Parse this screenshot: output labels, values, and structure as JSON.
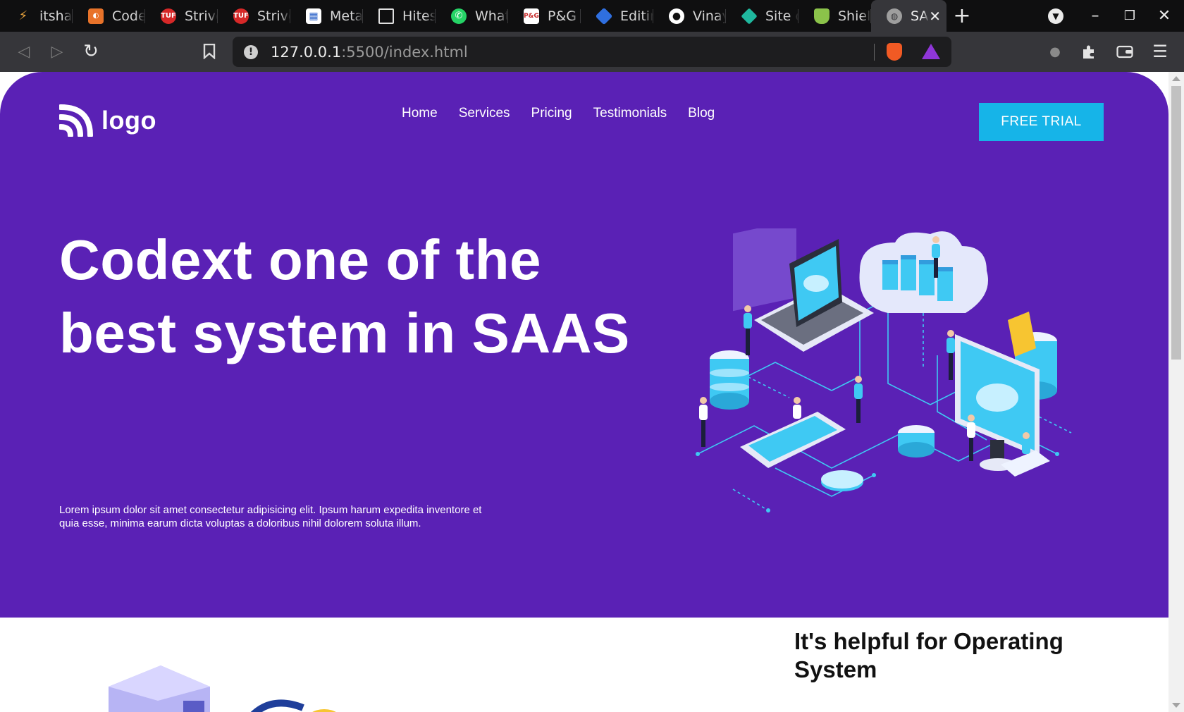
{
  "browser": {
    "tabs": [
      {
        "label": "itshar",
        "favicon": "orange-bolt-icon",
        "color": "#e8a33d"
      },
      {
        "label": "Code",
        "favicon": "codechef-icon",
        "color": "#e8732a"
      },
      {
        "label": "Strive",
        "favicon": "tuf-icon",
        "color": "#d62828"
      },
      {
        "label": "Strive",
        "favicon": "tuf-icon",
        "color": "#d62828"
      },
      {
        "label": "Meta",
        "favicon": "grid-icon",
        "color": "#2b63c9"
      },
      {
        "label": "Hites",
        "favicon": "square-outline-icon",
        "color": "#0f0f10"
      },
      {
        "label": "What",
        "favicon": "whatsapp-icon",
        "color": "#25d366"
      },
      {
        "label": "P&G F",
        "favicon": "pg-icon",
        "color": "#ffffff"
      },
      {
        "label": "Editin",
        "favicon": "diamond-icon",
        "color": "#2f6fe0"
      },
      {
        "label": "Vinay",
        "favicon": "github-icon",
        "color": "#ffffff"
      },
      {
        "label": "Site o",
        "favicon": "teal-diamond-icon",
        "color": "#1fb89e"
      },
      {
        "label": "Shiel",
        "favicon": "shield-icon",
        "color": "#8bc34a"
      },
      {
        "label": "SA",
        "favicon": "globe-icon",
        "color": "#9e9e9e",
        "active": true
      }
    ],
    "new_tab": "+",
    "url_host": "127.0.0.1",
    "url_path": ":5500/index.html"
  },
  "page": {
    "logo": "logo",
    "nav": [
      "Home",
      "Services",
      "Pricing",
      "Testimonials",
      "Blog"
    ],
    "cta": "FREE TRIAL",
    "headline": "Codext one of the best system in SAAS",
    "lead": "Lorem ipsum dolor sit amet consectetur adipisicing elit. Ipsum harum expedita inventore et quia esse, minima earum dicta voluptas a doloribus nihil dolorem soluta illum.",
    "section2_title": "It's helpful for Operating System"
  },
  "colors": {
    "hero_bg": "#5a21b5",
    "cta_bg": "#16b4e8",
    "chrome_bg": "#0f0f10",
    "toolbar_bg": "#36363a"
  }
}
